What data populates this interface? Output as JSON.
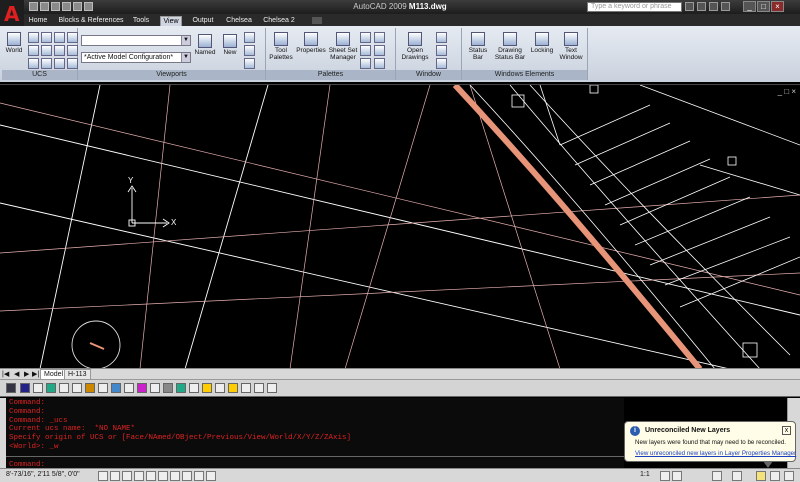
{
  "title": {
    "app": "AutoCAD 2009",
    "file": "M113.dwg"
  },
  "search": {
    "placeholder": "Type a keyword or phrase"
  },
  "window_controls": {
    "minimize": "_",
    "restore": "□",
    "close": "×"
  },
  "ribbon_tabs": [
    "Home",
    "Blocks & References",
    "Tools",
    "View",
    "Output",
    "Chelsea",
    "Chelsea 2"
  ],
  "active_tab": "View",
  "panels": {
    "ucs": {
      "label": "UCS",
      "world": "World"
    },
    "viewports": {
      "label": "Viewports",
      "combo1": "",
      "combo2": "*Active Model Configuration*",
      "named": "Named",
      "new": "New"
    },
    "palettes": {
      "label": "Palettes",
      "tool_palettes": "Tool Palettes",
      "properties": "Properties",
      "sheet_set": "Sheet Set Manager"
    },
    "window": {
      "label": "Window",
      "open_drawings": "Open Drawings"
    },
    "windows_elements": {
      "label": "Windows Elements",
      "status_bar": "Status Bar",
      "drawing_status_bar": "Drawing Status Bar",
      "locking": "Locking",
      "text_window": "Text Window"
    }
  },
  "ucs_icon": {
    "x": "X",
    "y": "Y"
  },
  "viewport_controls": "_ □ ×",
  "layout_tabs": {
    "model": "Model",
    "layout": "H-113"
  },
  "command_history": [
    "Command:",
    "Command:",
    "Command: _ucs",
    "Current ucs name:  *NO NAME*",
    "Specify origin of UCS or [Face/NAmed/OBject/Previous/View/World/X/Y/Z/ZAxis]",
    "<World>: _w",
    "",
    "Command:"
  ],
  "status": {
    "coords": "8'-73/16\", 2'11 5/8\", 0'0\"",
    "scale": "1:1"
  },
  "notification": {
    "title": "Unreconciled New Layers",
    "body": "New layers were found that may need to be reconciled.",
    "link": "View unreconciled new layers in Layer Properties Manager",
    "close": "x"
  },
  "colors": {
    "background": "#000000",
    "command_text": "#dd2222",
    "highlight_wall": "#e89478",
    "grid_line": "#ffffff",
    "accent_line": "#f0c0c0"
  }
}
